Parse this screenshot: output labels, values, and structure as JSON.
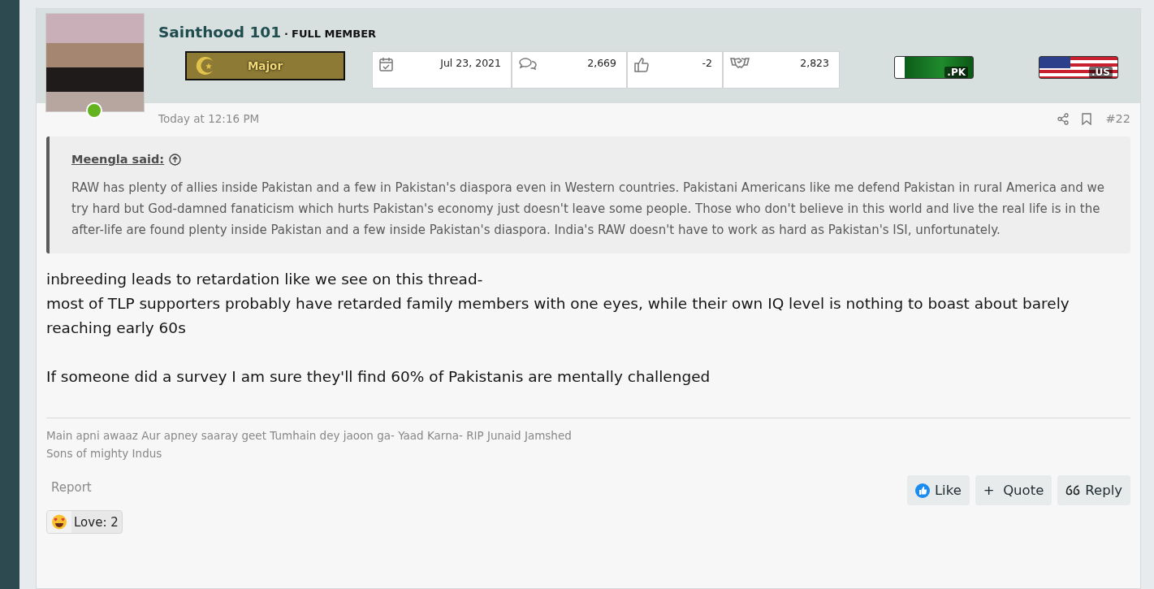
{
  "user": {
    "name": "Sainthood 101",
    "separator": "·",
    "title": "FULL MEMBER",
    "online": true,
    "rank": "Major"
  },
  "stats": [
    {
      "kind": "joined",
      "value": "Jul 23, 2021"
    },
    {
      "kind": "messages",
      "value": "2,669"
    },
    {
      "kind": "reactions",
      "value": "-2"
    },
    {
      "kind": "points",
      "value": "2,823"
    }
  ],
  "flags": [
    {
      "kind": "pakistan",
      "label": ".PK"
    },
    {
      "kind": "usa",
      "label": ".US"
    }
  ],
  "post": {
    "time": "Today at 12:16 PM",
    "number": "#22"
  },
  "quote": {
    "author": "Meengla said:",
    "text": "RAW has plenty of allies inside Pakistan and a few in Pakistan's diaspora even in Western countries. Pakistani Americans like me defend Pakistan in rural America and we try hard but God-damned fanaticism which hurts Pakistan's economy just doesn't leave some people. Those who don't believe in this world and live the real life is in the after-life are found plenty inside Pakistan and a few inside Pakistan's diaspora. India's RAW doesn't have to work as hard as Pakistan's ISI, unfortunately."
  },
  "message": [
    "inbreeding leads to retardation like we see on this thread-\nmost of TLP supporters probably have retarded family members with one eyes, while their own IQ level is nothing to boast about barely reaching early 60s",
    "If someone did a survey I am sure they'll find 60% of Pakistanis are mentally challenged"
  ],
  "signature": [
    "Main apni awaaz Aur apney saaray geet Tumhain dey jaoon ga- Yaad Karna- RIP Junaid Jamshed",
    "Sons of mighty Indus"
  ],
  "report": "Report",
  "actions": [
    {
      "kind": "like",
      "label": "Like"
    },
    {
      "kind": "quote",
      "icon": "+",
      "label": "Quote"
    },
    {
      "kind": "reply",
      "label": "Reply"
    }
  ],
  "reactions": [
    {
      "kind": "love",
      "label": "Love: 2"
    }
  ]
}
